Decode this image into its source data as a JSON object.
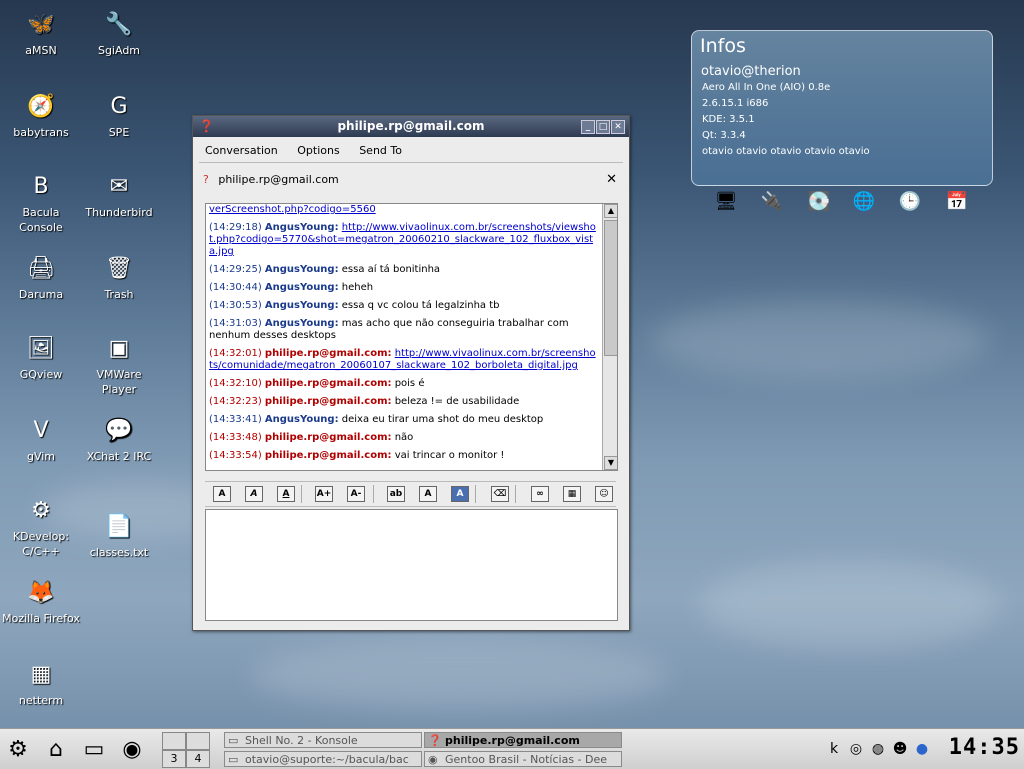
{
  "desktop": {
    "icons": [
      {
        "label": "aMSN",
        "icon": "butterfly-icon"
      },
      {
        "label": "SgiAdm",
        "icon": "wrench-icon"
      },
      {
        "label": "babytrans",
        "icon": "compass-icon"
      },
      {
        "label": "SPE",
        "icon": "python-editor-icon"
      },
      {
        "label": "Bacula Console",
        "icon": "bacula-icon"
      },
      {
        "label": "Thunderbird",
        "icon": "thunderbird-icon"
      },
      {
        "label": "Daruma",
        "icon": "printer-icon"
      },
      {
        "label": "Trash",
        "icon": "trash-icon"
      },
      {
        "label": "GQview",
        "icon": "image-viewer-icon"
      },
      {
        "label": "VMWare Player",
        "icon": "vmware-icon"
      },
      {
        "label": "gVim",
        "icon": "vim-icon"
      },
      {
        "label": "XChat 2 IRC",
        "icon": "xchat-icon"
      },
      {
        "label": "KDevelop: C/C++",
        "icon": "kdevelop-icon"
      },
      {
        "label": "classes.txt",
        "icon": "text-file-icon"
      },
      {
        "label": "Mozilla Firefox",
        "icon": "firefox-icon"
      },
      {
        "label": "netterm",
        "icon": "terminal-window-icon"
      }
    ]
  },
  "infos": {
    "title": "Infos",
    "host": "otavio@therion",
    "lines": [
      "Aero All In One (AIO) 0.8e",
      "2.6.15.1 i686",
      "KDE: 3.5.1",
      "Qt: 3.3.4",
      "otavio otavio otavio otavio otavio"
    ],
    "tray_icons": [
      "computer-icon",
      "devices-icon",
      "harddisk-icon",
      "network-globe-icon",
      "clock-icon",
      "calendar-icon"
    ]
  },
  "chat_window": {
    "title": "philipe.rp@gmail.com",
    "menu": [
      "Conversation",
      "Options",
      "Send To"
    ],
    "contact": "philipe.rp@gmail.com",
    "messages": [
      {
        "time": "",
        "nick": "",
        "text": "",
        "link": "verScreenshot.php?codigo=5560",
        "who": "a"
      },
      {
        "time": "(14:29:18)",
        "nick": "AngusYoung:",
        "text": "",
        "link": "http://www.vivaolinux.com.br/screenshots/viewshot.php?codigo=5770&shot=megatron_20060210_slackware_102_fluxbox_vista.jpg",
        "who": "a"
      },
      {
        "time": "(14:29:25)",
        "nick": "AngusYoung:",
        "text": "essa aí tá bonitinha",
        "link": "",
        "who": "a"
      },
      {
        "time": "(14:30:44)",
        "nick": "AngusYoung:",
        "text": "heheh",
        "link": "",
        "who": "a"
      },
      {
        "time": "(14:30:53)",
        "nick": "AngusYoung:",
        "text": "essa q vc colou tá legalzinha tb",
        "link": "",
        "who": "a"
      },
      {
        "time": "(14:31:03)",
        "nick": "AngusYoung:",
        "text": "mas acho que não conseguiria trabalhar com nenhum desses desktops",
        "link": "",
        "who": "a"
      },
      {
        "time": "(14:32:01)",
        "nick": "philipe.rp@gmail.com:",
        "text": "",
        "link": "http://www.vivaolinux.com.br/screenshots/comunidade/megatron_20060107_slackware_102_borboleta_digital.jpg",
        "who": "p"
      },
      {
        "time": "(14:32:10)",
        "nick": "philipe.rp@gmail.com:",
        "text": "pois é",
        "link": "",
        "who": "p"
      },
      {
        "time": "(14:32:23)",
        "nick": "philipe.rp@gmail.com:",
        "text": "beleza != de usabilidade",
        "link": "",
        "who": "p"
      },
      {
        "time": "(14:33:41)",
        "nick": "AngusYoung:",
        "text": "deixa eu tirar uma shot do meu desktop",
        "link": "",
        "who": "a"
      },
      {
        "time": "(14:33:48)",
        "nick": "philipe.rp@gmail.com:",
        "text": "não",
        "link": "",
        "who": "p"
      },
      {
        "time": "(14:33:54)",
        "nick": "philipe.rp@gmail.com:",
        "text": "vai trincar o monitor !",
        "link": "",
        "who": "p"
      }
    ],
    "toolbar": [
      {
        "name": "bold-button",
        "glyph": "A"
      },
      {
        "name": "italic-button",
        "glyph": "A"
      },
      {
        "name": "underline-button",
        "glyph": "A"
      },
      {
        "name": "increase-font-button",
        "glyph": "A+"
      },
      {
        "name": "decrease-font-button",
        "glyph": "A-"
      },
      {
        "name": "font-face-button",
        "glyph": "ab"
      },
      {
        "name": "foreground-color-button",
        "glyph": "A"
      },
      {
        "name": "background-color-button",
        "glyph": "A"
      },
      {
        "name": "clear-formatting-button",
        "glyph": "⌫"
      },
      {
        "name": "insert-link-button",
        "glyph": "∞"
      },
      {
        "name": "insert-image-button",
        "glyph": "▦"
      },
      {
        "name": "insert-smiley-button",
        "glyph": "☺"
      }
    ]
  },
  "taskbar": {
    "pager": [
      "3",
      "4"
    ],
    "tasks": [
      {
        "label": "Shell No. 2 - Konsole",
        "active": false
      },
      {
        "label": "philipe.rp@gmail.com",
        "active": true
      },
      {
        "label": "otavio@suporte:~/bacula/bac",
        "active": false
      },
      {
        "label": "Gentoo Brasil - Notícias - Dee",
        "active": false
      }
    ],
    "clock": "14:35"
  }
}
